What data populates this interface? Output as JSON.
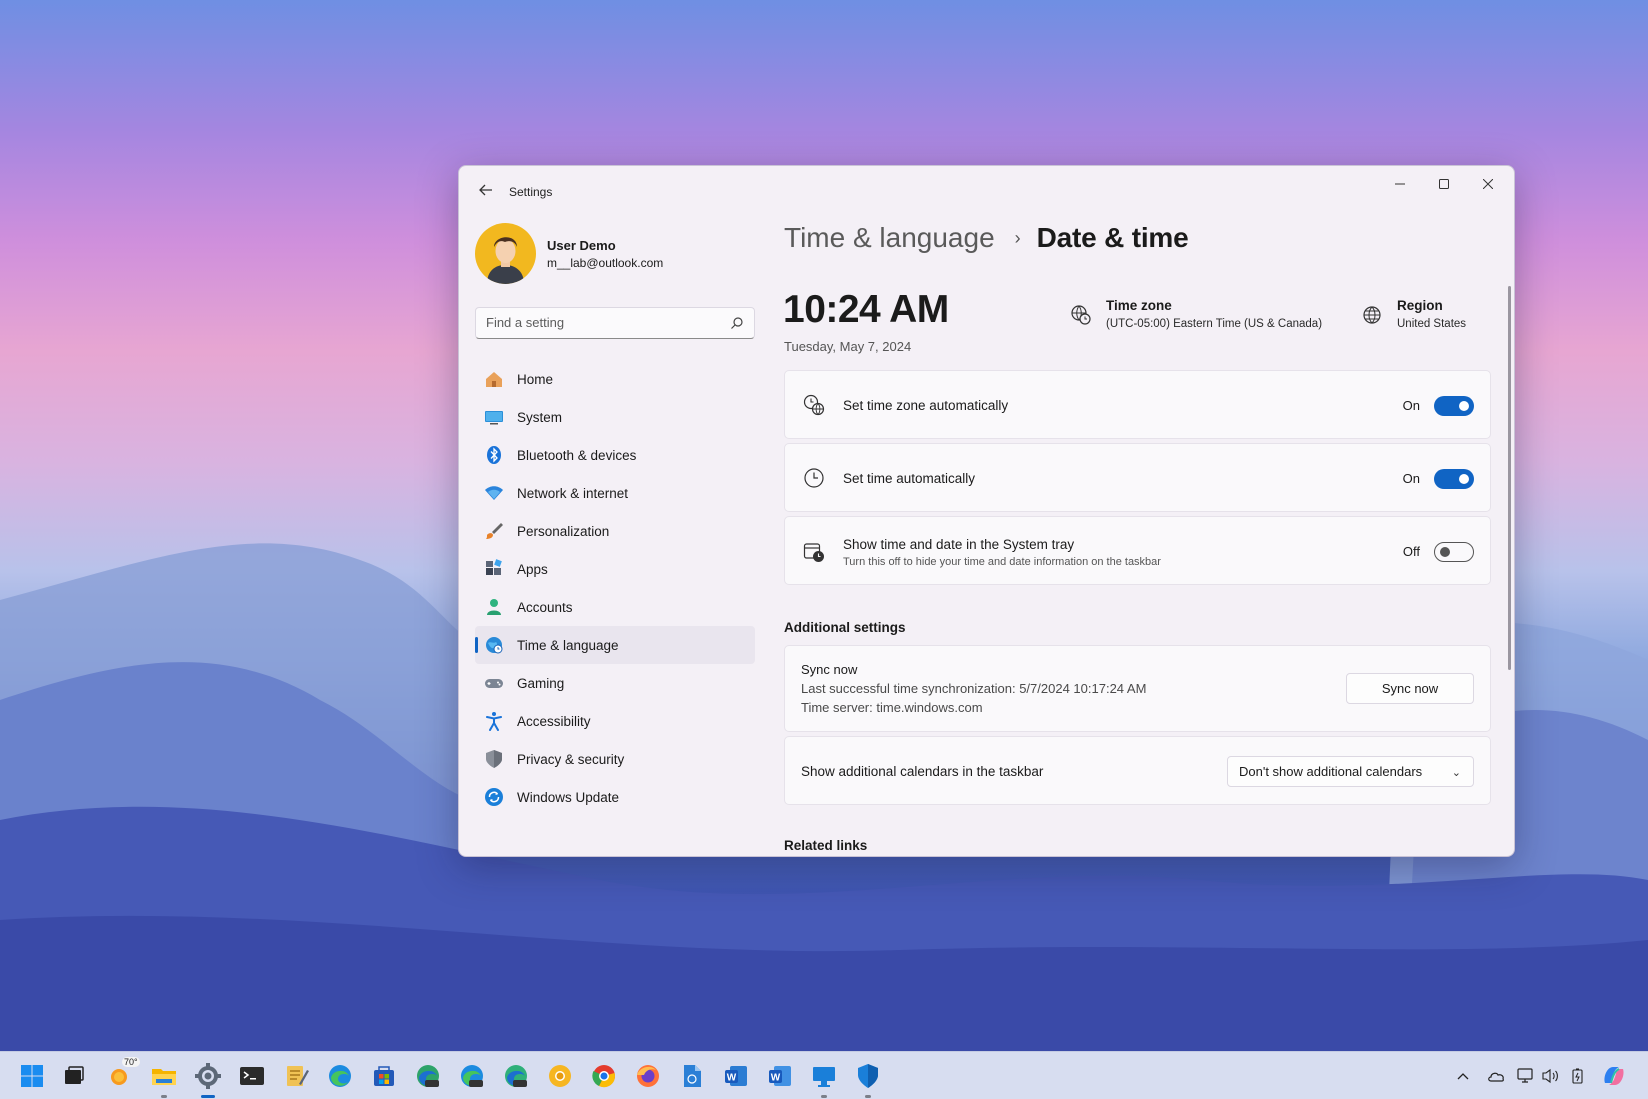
{
  "window": {
    "app_title": "Settings",
    "back_icon": "back-arrow-icon",
    "controls": {
      "minimize_icon": "minimize-icon",
      "maximize_icon": "maximize-icon",
      "close_icon": "close-icon"
    }
  },
  "profile": {
    "name": "User Demo",
    "email": "m__lab@outlook.com"
  },
  "search": {
    "placeholder": "Find a setting",
    "icon": "search-icon"
  },
  "sidebar": {
    "items": [
      {
        "label": "Home",
        "icon": "home-icon"
      },
      {
        "label": "System",
        "icon": "monitor-icon"
      },
      {
        "label": "Bluetooth & devices",
        "icon": "bluetooth-icon"
      },
      {
        "label": "Network & internet",
        "icon": "wifi-icon"
      },
      {
        "label": "Personalization",
        "icon": "brush-icon"
      },
      {
        "label": "Apps",
        "icon": "apps-icon"
      },
      {
        "label": "Accounts",
        "icon": "person-icon"
      },
      {
        "label": "Time & language",
        "icon": "globe-clock-icon",
        "active": true
      },
      {
        "label": "Gaming",
        "icon": "gamepad-icon"
      },
      {
        "label": "Accessibility",
        "icon": "accessibility-icon"
      },
      {
        "label": "Privacy & security",
        "icon": "shield-icon"
      },
      {
        "label": "Windows Update",
        "icon": "update-icon"
      }
    ]
  },
  "header": {
    "parent": "Time & language",
    "separator": "›",
    "current": "Date & time"
  },
  "clock": {
    "time": "10:24 AM",
    "date": "Tuesday, May 7, 2024"
  },
  "time_zone": {
    "label": "Time zone",
    "value": "(UTC-05:00) Eastern Time (US & Canada)"
  },
  "region": {
    "label": "Region",
    "value": "United States"
  },
  "settings": [
    {
      "title": "Set time zone automatically",
      "state": "On",
      "on": true,
      "icon": "globe-clock-icon"
    },
    {
      "title": "Set time automatically",
      "state": "On",
      "on": true,
      "icon": "clock-icon"
    },
    {
      "title": "Show time and date in the System tray",
      "description": "Turn this off to hide your time and date information on the taskbar",
      "state": "Off",
      "on": false,
      "icon": "calendar-clock-icon"
    }
  ],
  "additional": {
    "header": "Additional settings",
    "sync": {
      "title": "Sync now",
      "last_sync": "Last successful time synchronization: 5/7/2024 10:17:24 AM",
      "server": "Time server: time.windows.com",
      "button": "Sync now"
    },
    "calendars": {
      "label": "Show additional calendars in the taskbar",
      "selected": "Don't show additional calendars"
    }
  },
  "related_links": {
    "header": "Related links"
  },
  "taskbar": {
    "weather_temp": "70°",
    "apps": [
      "start-icon",
      "task-view-icon",
      "weather-icon",
      "file-explorer-icon",
      "settings-icon",
      "terminal-icon",
      "notepad-icon",
      "edge-icon",
      "store-icon",
      "edge-canary-icon",
      "edge-beta-icon",
      "edge-dev-icon",
      "chrome-canary-icon",
      "chrome-icon",
      "firefox-icon",
      "document-icon",
      "word-icon",
      "word-alt-icon",
      "remote-desktop-icon",
      "defender-icon"
    ],
    "tray": [
      "chevron-up-icon",
      "onedrive-icon",
      "network-icon",
      "volume-icon",
      "battery-icon",
      "copilot-icon"
    ]
  },
  "colors": {
    "accent": "#1064c4",
    "window_bg": "#f4f0f6",
    "taskbar_bg": "#d7ddf0"
  }
}
